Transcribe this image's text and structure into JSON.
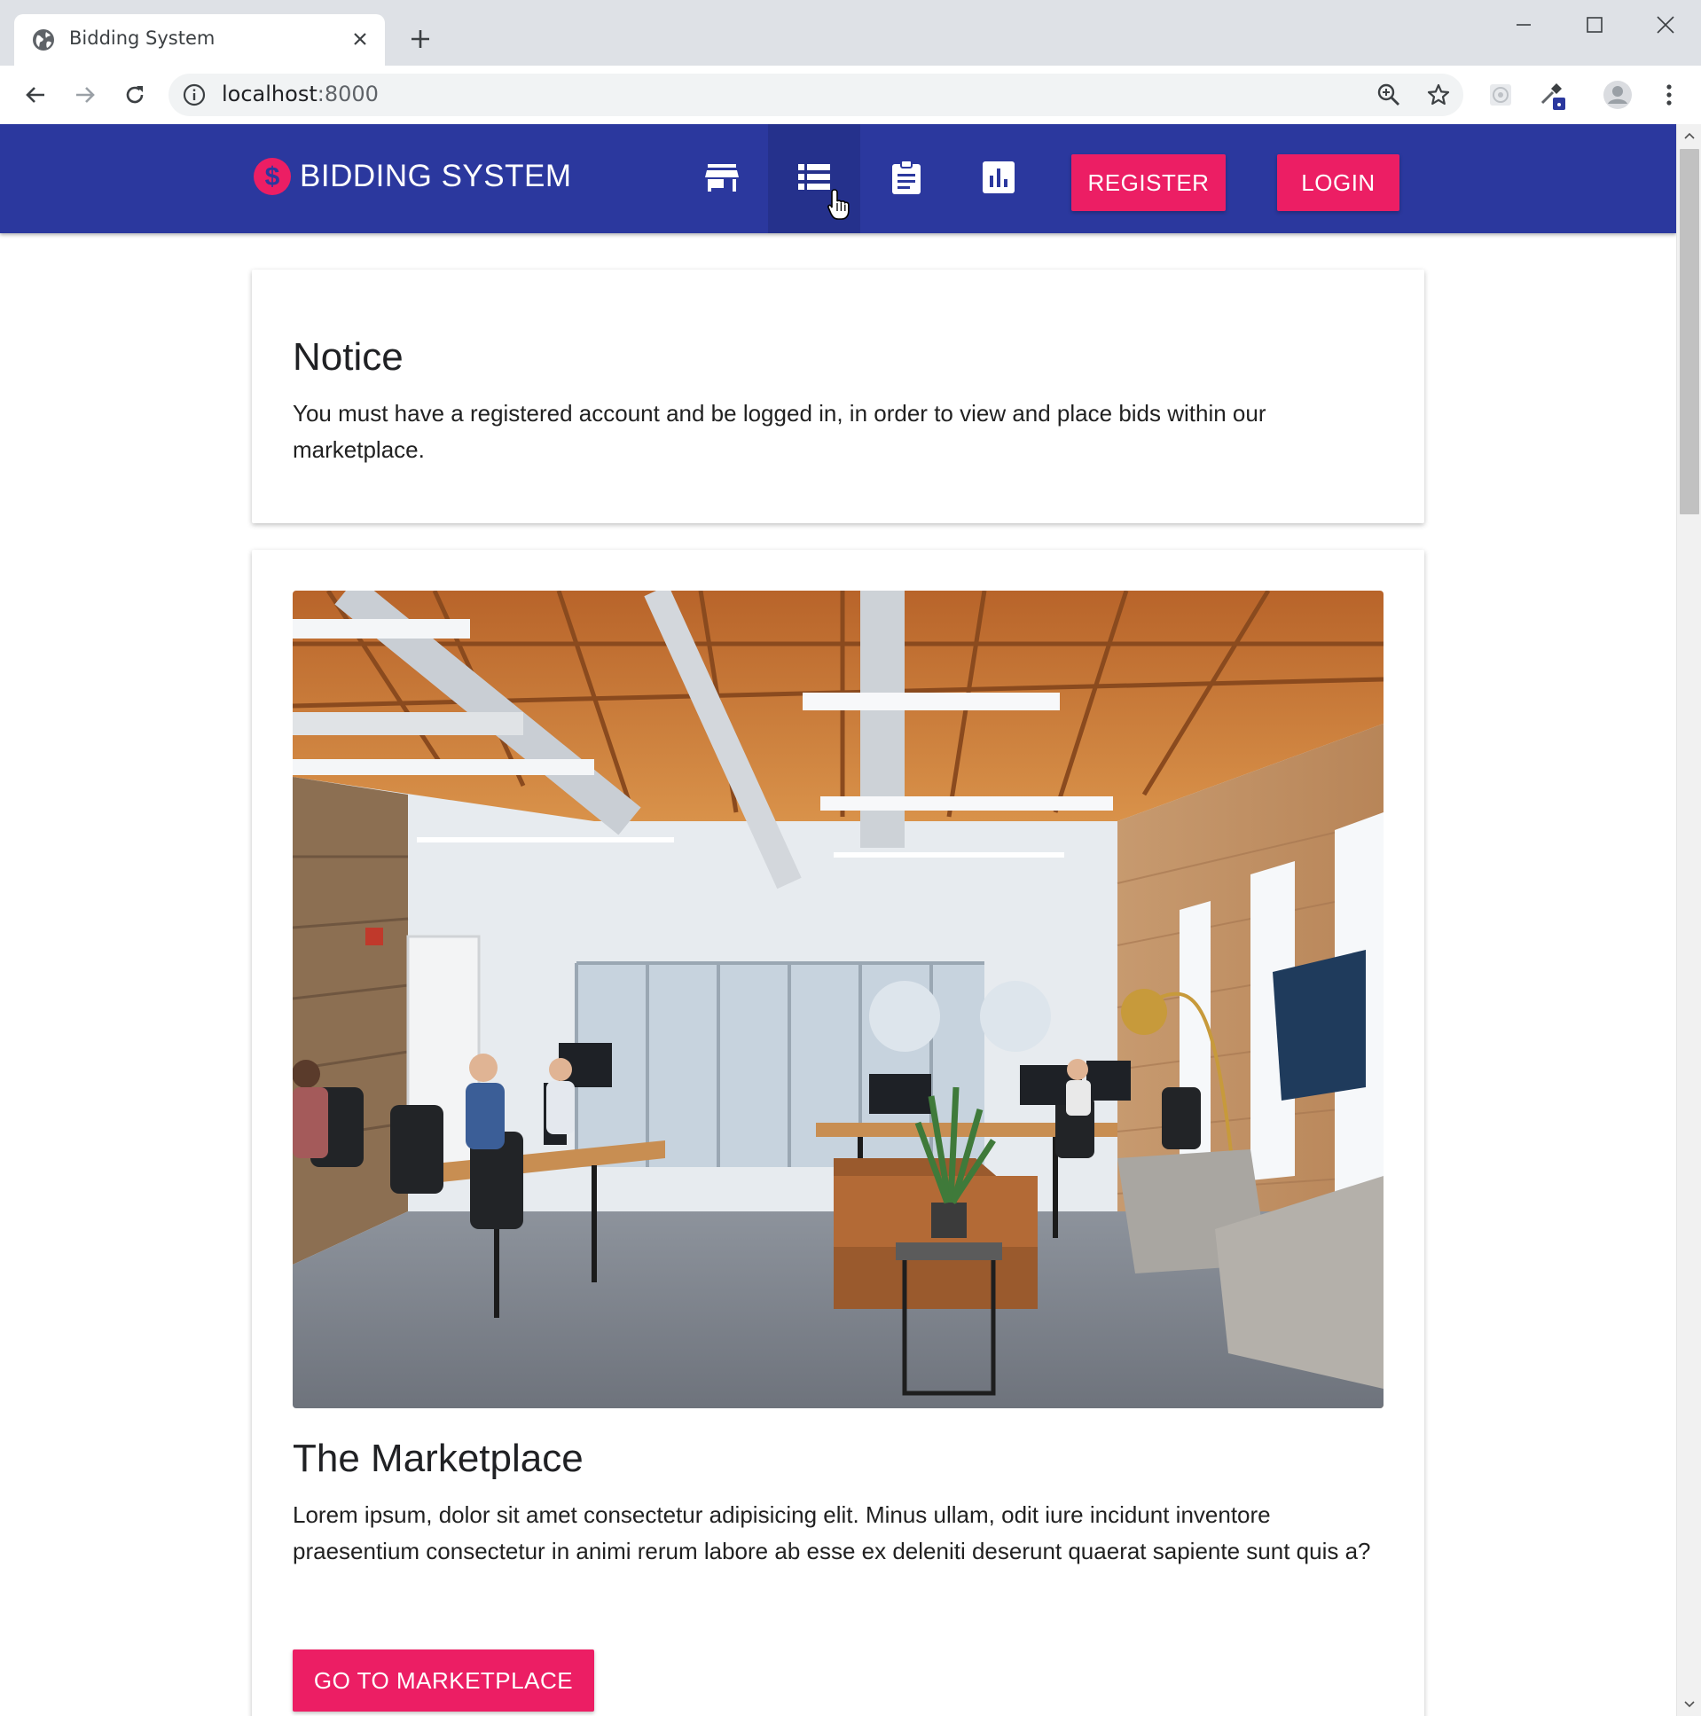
{
  "browser": {
    "tab_title": "Bidding System",
    "url_host": "localhost",
    "url_port": ":8000",
    "icons": {
      "favicon": "globe-icon",
      "close": "close-icon",
      "new_tab": "plus-icon",
      "back": "arrow-left-icon",
      "forward": "arrow-right-icon",
      "reload": "reload-icon",
      "info": "info-icon",
      "zoom": "zoom-icon",
      "bookmark": "star-icon",
      "extension_1": "extension-icon",
      "extension_2": "eyedropper-icon",
      "profile": "avatar-icon",
      "menu": "kebab-menu-icon",
      "minimize": "minimize-icon",
      "maximize": "maximize-icon",
      "close_window": "close-window-icon"
    }
  },
  "app": {
    "brand": "BIDDING SYSTEM",
    "brand_icon": "dollar-icon",
    "nav": [
      {
        "name": "store-icon"
      },
      {
        "name": "list-icon",
        "active": true
      },
      {
        "name": "clipboard-icon"
      },
      {
        "name": "bar-chart-icon"
      }
    ],
    "register_label": "REGISTER",
    "login_label": "LOGIN",
    "colors": {
      "primary": "#2b389e",
      "accent": "#ec1e64"
    }
  },
  "notice": {
    "title": "Notice",
    "text": "You must have a registered account and be logged in, in order to view and place bids within our marketplace."
  },
  "marketplace": {
    "title": "The Marketplace",
    "text": "Lorem ipsum, dolor sit amet consectetur adipisicing elit. Minus ullam, odit iure incidunt inventore praesentium consectetur in animi rerum labore ab esse ex deleniti deserunt quaerat sapiente sunt quis a?",
    "button_label": "GO TO MARKETPLACE",
    "image": "office-photo"
  }
}
